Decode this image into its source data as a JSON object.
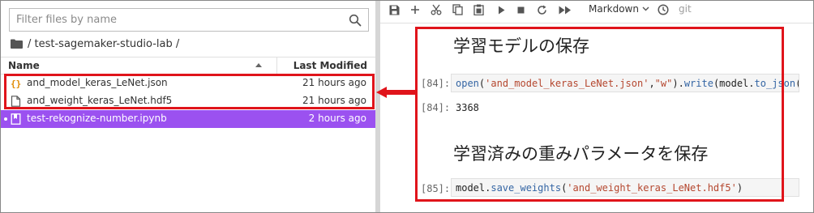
{
  "browser": {
    "search_placeholder": "Filter files by name",
    "breadcrumb": "/ test-sagemaker-studio-lab /",
    "col_name": "Name",
    "col_modified": "Last Modified",
    "files": [
      {
        "name": "and_model_keras_LeNet.json",
        "modified": "21 hours ago",
        "icon": "json-icon"
      },
      {
        "name": "and_weight_keras_LeNet.hdf5",
        "modified": "21 hours ago",
        "icon": "file-icon"
      },
      {
        "name": "test-rekognize-number.ipynb",
        "modified": "2 hours ago",
        "icon": "notebook-icon",
        "selected": true
      }
    ]
  },
  "notebook": {
    "toolbar": {
      "cell_type": "Markdown",
      "git": "git",
      "icons": [
        "save-icon",
        "add-cell-icon",
        "cut-icon",
        "copy-icon",
        "paste-icon",
        "run-icon",
        "stop-icon",
        "restart-icon",
        "fast-forward-icon",
        "clock-icon"
      ]
    },
    "cells": {
      "md1": "学習モデルの保存",
      "in84_prompt": "[84]:",
      "in84_code": {
        "fn_open": "open",
        "p1": "(",
        "arg1": "'and_model_keras_LeNet.json'",
        "comma": ",",
        "arg2": "\"w\"",
        "p2": ").",
        "fn_write": "write",
        "p3": "(model.",
        "fn_to_json": "to_json",
        "p4": "())"
      },
      "out84_prompt": "[84]:",
      "out84_value": "3368",
      "md2": "学習済みの重みパラメータを保存",
      "in85_prompt": "[85]:",
      "in85_code": {
        "p1": "model.",
        "fn_save": "save_weights",
        "p2": "(",
        "arg": "'and_weight_keras_LeNet.hdf5'",
        "p3": ")"
      }
    }
  },
  "colors": {
    "selection": "#9b51f0",
    "highlight": "#e0141b",
    "string": "#b5472f",
    "function": "#3465a4"
  }
}
